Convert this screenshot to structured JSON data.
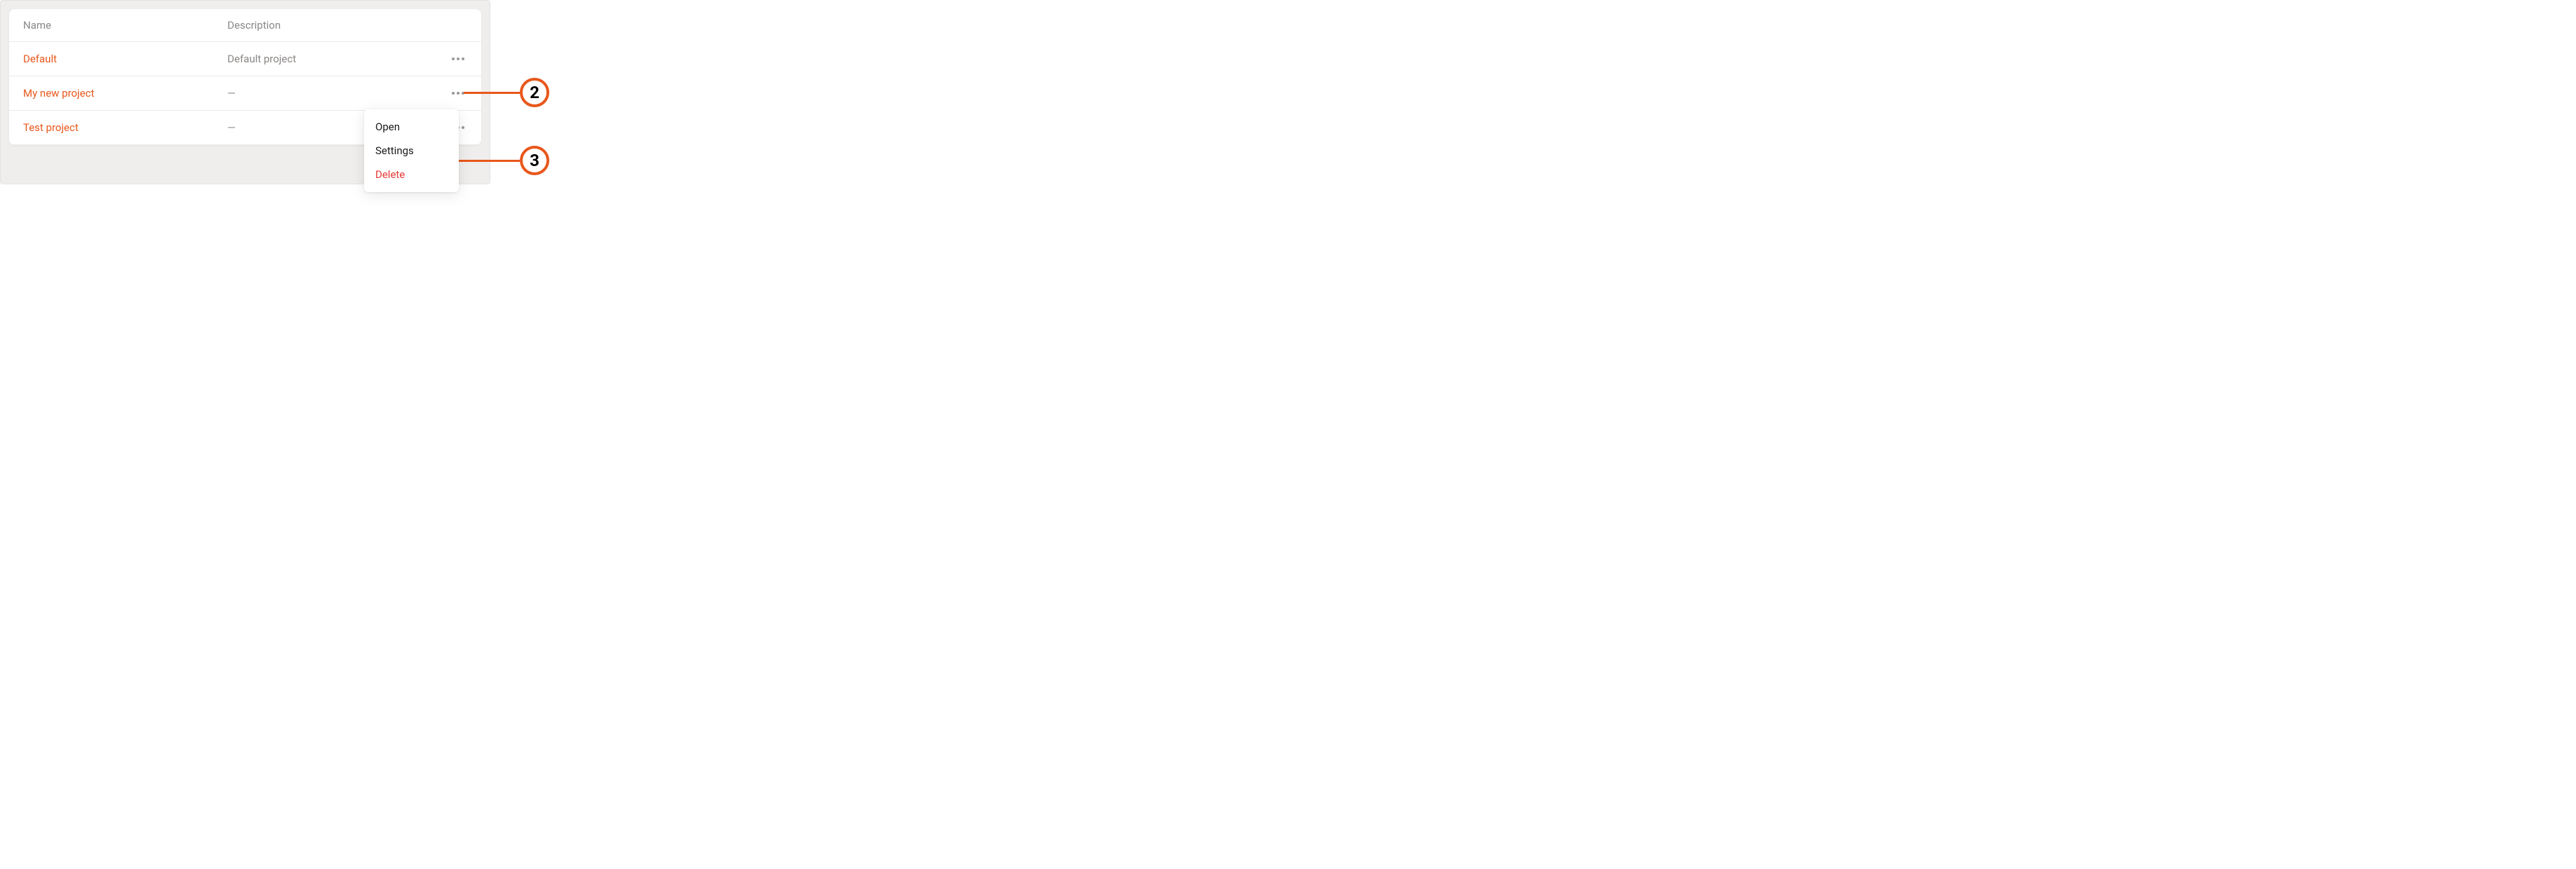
{
  "table": {
    "headers": {
      "name": "Name",
      "description": "Description"
    },
    "rows": [
      {
        "name": "Default",
        "description": "Default project"
      },
      {
        "name": "My new project",
        "description": "—"
      },
      {
        "name": "Test project",
        "description": "—"
      }
    ]
  },
  "menu": {
    "open": "Open",
    "settings": "Settings",
    "delete": "Delete"
  },
  "annotations": {
    "two": "2",
    "three": "3"
  }
}
